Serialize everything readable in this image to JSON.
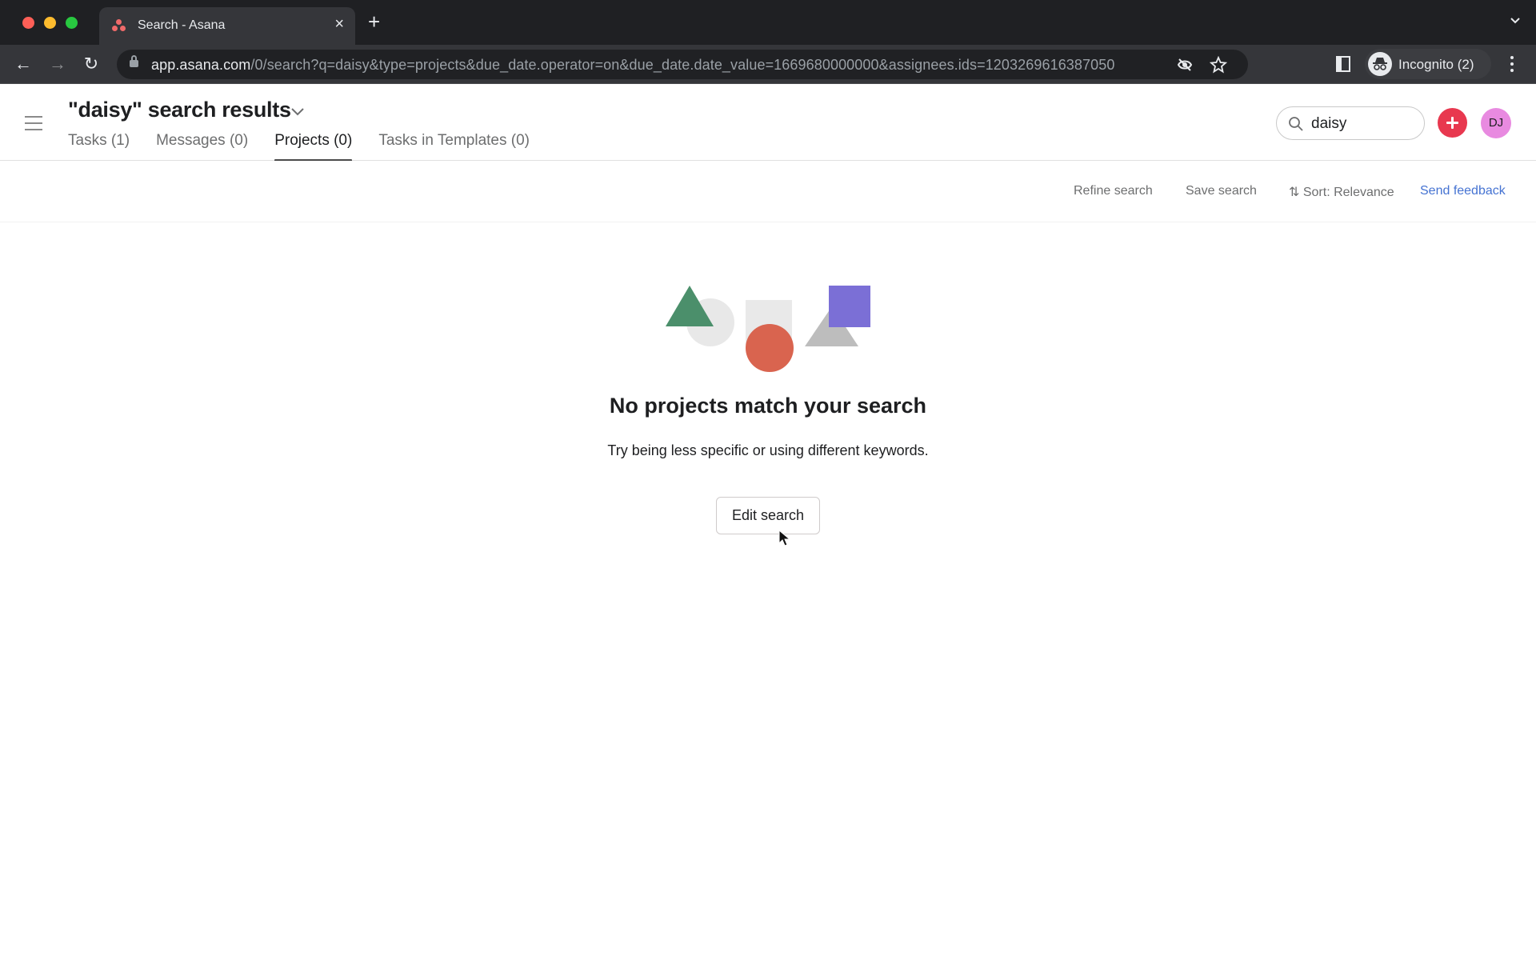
{
  "browser": {
    "tab_title": "Search - Asana",
    "url_host": "app.asana.com",
    "url_path": "/0/search?q=daisy&type=projects&due_date.operator=on&due_date.date_value=1669680000000&assignees.ids=1203269616387050",
    "profile_label": "Incognito (2)",
    "icons": {
      "back": "arrow-left-icon",
      "forward": "arrow-right-icon",
      "reload": "reload-icon",
      "lock": "lock-icon",
      "tracking": "eye-off-icon",
      "bookmark": "star-icon",
      "side_panel": "side-panel-icon",
      "menu": "kebab-icon"
    }
  },
  "header": {
    "title": "\"daisy\" search results",
    "tabs": [
      {
        "label": "Tasks (1)",
        "active": false
      },
      {
        "label": "Messages (0)",
        "active": false
      },
      {
        "label": "Projects (0)",
        "active": true
      },
      {
        "label": "Tasks in Templates (0)",
        "active": false
      }
    ],
    "search_value": "daisy",
    "avatar_initials": "DJ",
    "colors": {
      "add_button": "#e8384f",
      "avatar": "#e88ae0"
    }
  },
  "actions": {
    "refine": "Refine search",
    "save": "Save search",
    "sort": "Sort: Relevance",
    "feedback": "Send feedback",
    "feedback_color": "#4573d2"
  },
  "empty_state": {
    "heading": "No projects match your search",
    "subtitle": "Try being less specific or using different keywords.",
    "button": "Edit search"
  }
}
